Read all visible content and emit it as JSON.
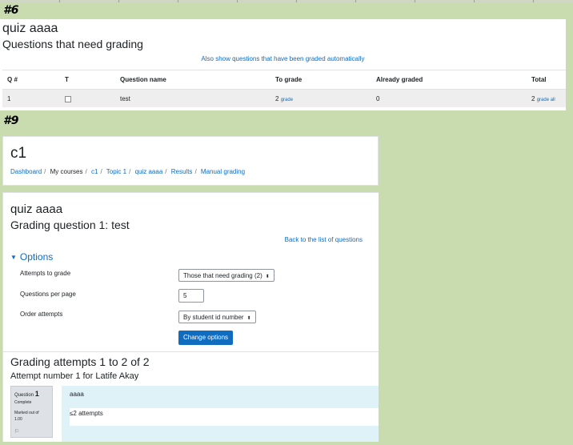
{
  "labels": {
    "first": "#6",
    "second": "#9"
  },
  "report": {
    "quiz_title": "quiz aaaa",
    "heading": "Questions that need grading",
    "also_show_link": "Also show questions that have been graded automatically",
    "columns": [
      "Q #",
      "T",
      "Question name",
      "To grade",
      "Already graded",
      "Total"
    ],
    "row": {
      "q_num": "1",
      "question_name": "test",
      "to_grade_count": "2",
      "to_grade_link": "grade",
      "already_graded": "0",
      "total_count": "2",
      "total_link": "grade all"
    }
  },
  "course": {
    "title": "c1",
    "breadcrumb": [
      "Dashboard",
      "My courses",
      "c1",
      "Topic 1",
      "quiz aaaa",
      "Results",
      "Manual grading"
    ]
  },
  "grading": {
    "quiz_title": "quiz aaaa",
    "question_heading": "Grading question 1: test",
    "back_link": "Back to the list of questions",
    "options_label": "Options",
    "attempts_label": "Attempts to grade",
    "attempts_value": "Those that need grading (2)",
    "per_page_label": "Questions per page",
    "per_page_value": "5",
    "order_label": "Order attempts",
    "order_value": "By student id number",
    "change_button": "Change options",
    "grading_heading": "Grading attempts 1 to 2 of 2",
    "attempt_heading": "Attempt number 1 for Latife Akay",
    "question_info": {
      "label": "Question",
      "number": "1",
      "state": "Complete",
      "marked_line1": "Marked out of",
      "marked_line2": "1.00"
    },
    "question_text": "aaaa",
    "response": "≤2 attempts"
  },
  "colors": {
    "link": "#0f6cbf",
    "background": "#c8dcb0",
    "button": "#0f6cbf",
    "question_bg": "#def2f8"
  }
}
